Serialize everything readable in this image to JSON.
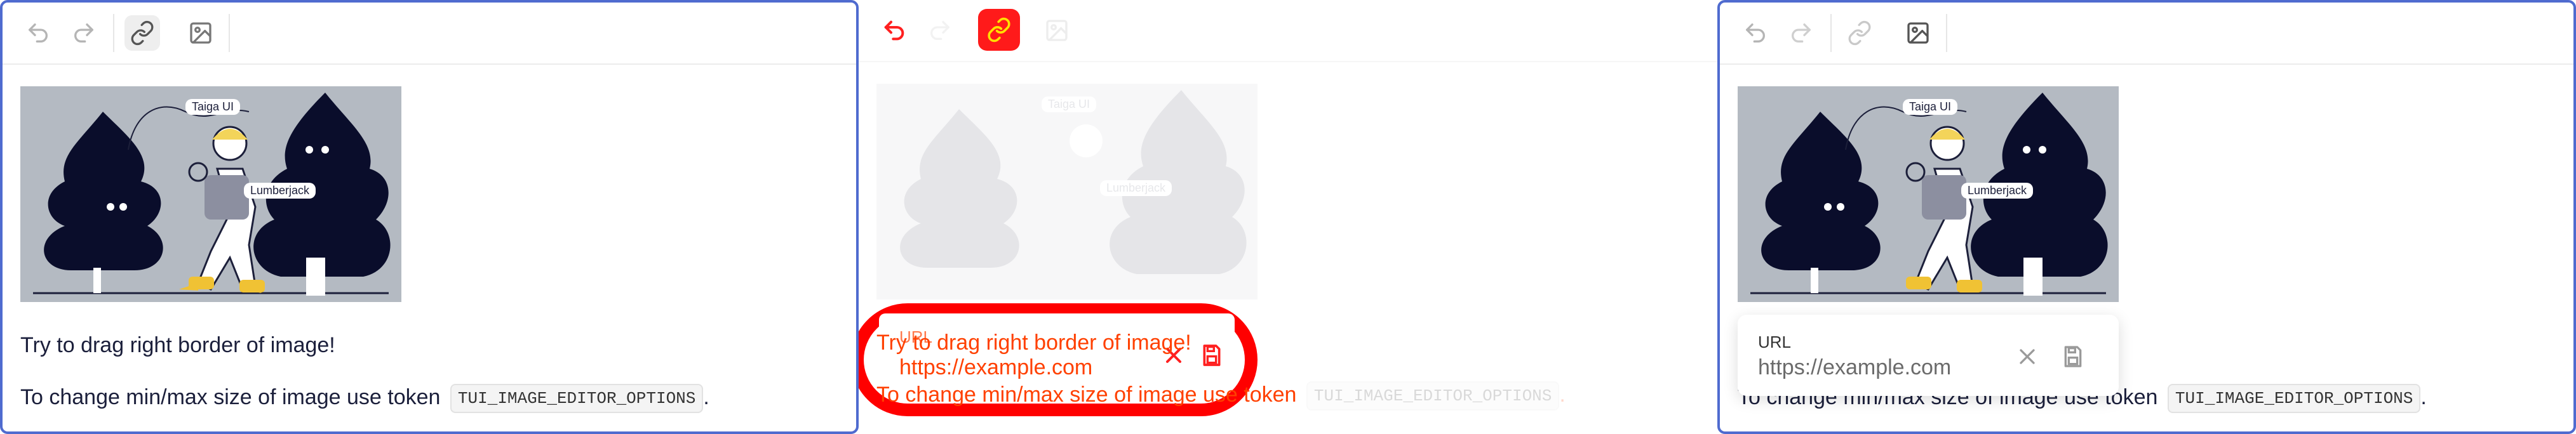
{
  "image_labels": {
    "tag_top": "Taiga UI",
    "tag_mid": "Lumberjack"
  },
  "paragraph1": "Try to drag right border of image!",
  "paragraph2_prefix": "To change min/max size of image use token",
  "paragraph2_token": "TUI_IMAGE_EDITOR_OPTIONS",
  "paragraph2_suffix": ".",
  "link_dialog": {
    "label": "URL",
    "placeholder": "https://example.com"
  },
  "colors": {
    "border": "#4f6bcf",
    "highlight": "#ff1a1a",
    "accent_text": "#ff4000"
  },
  "icons": [
    "undo-icon",
    "redo-icon",
    "link-icon",
    "image-icon",
    "close-icon",
    "save-icon"
  ]
}
